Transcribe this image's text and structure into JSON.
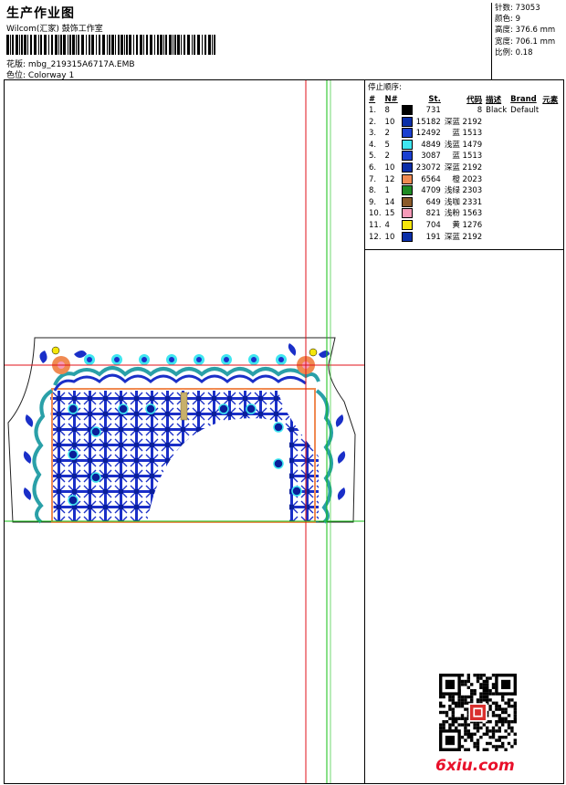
{
  "header": {
    "title": "生产作业图",
    "company": "Wilcom(汇家) 鼓饰工作室",
    "design_file_label": "花版:",
    "design_file": "mbg_219315A6717A.EMB",
    "colorway_label": "色位:",
    "colorway": "Colorway 1"
  },
  "stats": {
    "stitches": "针数: 73053",
    "colors": "颜色: 9",
    "height": "高度: 376.6 mm",
    "width": "宽度: 706.1 mm",
    "scale": "比例: 0.18"
  },
  "legend": {
    "title": "停止顺序:",
    "columns": [
      "#",
      "N#",
      "St.",
      "代码",
      "描述",
      "Brand",
      "元素"
    ],
    "rows": [
      {
        "num": "1.",
        "needle": "8",
        "st": "731",
        "code": "8",
        "desc": "Black",
        "brand": "Default",
        "color": "#000000"
      },
      {
        "num": "2.",
        "needle": "10",
        "st": "15182",
        "code": "深蓝 2192",
        "desc": "",
        "brand": "",
        "color": "#0a2ea8"
      },
      {
        "num": "3.",
        "needle": "2",
        "st": "12492",
        "code": "蓝 1513",
        "desc": "",
        "brand": "",
        "color": "#1a3fd0"
      },
      {
        "num": "4.",
        "needle": "5",
        "st": "4849",
        "code": "浅蓝 1479",
        "desc": "",
        "brand": "",
        "color": "#3fe6f0"
      },
      {
        "num": "5.",
        "needle": "2",
        "st": "3087",
        "code": "蓝 1513",
        "desc": "",
        "brand": "",
        "color": "#1a3fd0"
      },
      {
        "num": "6.",
        "needle": "10",
        "st": "23072",
        "code": "深蓝 2192",
        "desc": "",
        "brand": "",
        "color": "#0a2ea8"
      },
      {
        "num": "7.",
        "needle": "12",
        "st": "6564",
        "code": "橙 2023",
        "desc": "",
        "brand": "",
        "color": "#f08a52"
      },
      {
        "num": "8.",
        "needle": "1",
        "st": "4709",
        "code": "浅绿 2303",
        "desc": "",
        "brand": "",
        "color": "#1e8a24"
      },
      {
        "num": "9.",
        "needle": "14",
        "st": "649",
        "code": "浅咖 2331",
        "desc": "",
        "brand": "",
        "color": "#8a5a2a"
      },
      {
        "num": "10.",
        "needle": "15",
        "st": "821",
        "code": "浅粉 1563",
        "desc": "",
        "brand": "",
        "color": "#f59ab8"
      },
      {
        "num": "11.",
        "needle": "4",
        "st": "704",
        "code": "黄 1276",
        "desc": "",
        "brand": "",
        "color": "#f5e60a"
      },
      {
        "num": "12.",
        "needle": "10",
        "st": "191",
        "code": "深蓝 2192",
        "desc": "",
        "brand": "",
        "color": "#0a2ea8"
      }
    ]
  },
  "watermark": {
    "site": "6xiu.com"
  },
  "colors": {
    "guide_red": "#e0101a",
    "guide_green": "#12c012",
    "embroidery_blue": "#1a2fc8",
    "teal": "#2aa0a8",
    "orange": "#f08a52"
  }
}
